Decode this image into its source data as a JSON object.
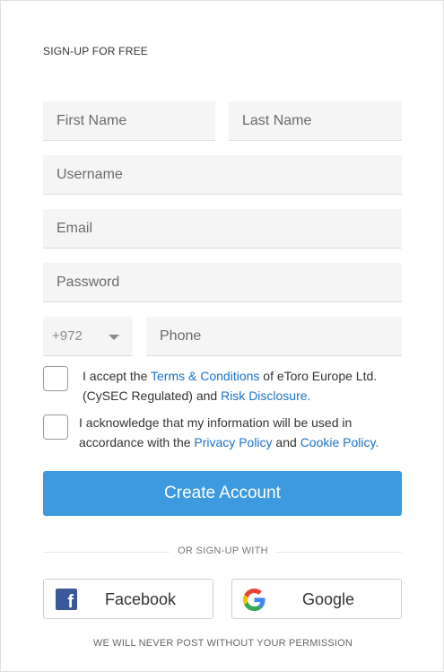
{
  "form": {
    "title": "SIGN-UP FOR FREE",
    "first_name_placeholder": "First Name",
    "last_name_placeholder": "Last Name",
    "username_placeholder": "Username",
    "email_placeholder": "Email",
    "password_placeholder": "Password",
    "country_code": "+972",
    "phone_placeholder": "Phone"
  },
  "terms": {
    "text1": "I accept the ",
    "terms_link": "Terms & Conditions",
    "text2": " of eToro Europe Ltd. (CySEC Regulated) and ",
    "risk_link": "Risk Disclosure."
  },
  "privacy": {
    "text1": "I acknowledge that my information will be used in accordance with the ",
    "privacy_link": "Privacy Policy",
    "text2": " and ",
    "cookie_link": "Cookie Policy."
  },
  "create_button": "Create Account",
  "divider_text": "OR SIGN-UP WITH",
  "social": {
    "facebook_label": "Facebook",
    "google_label": "Google"
  },
  "footer": "WE WILL NEVER POST WITHOUT YOUR PERMISSION",
  "colors": {
    "primary": "#3e9ade",
    "link": "#1a73c8",
    "facebook": "#3b5998"
  },
  "icons": [
    "chevron-down-icon",
    "facebook-icon",
    "google-icon"
  ]
}
